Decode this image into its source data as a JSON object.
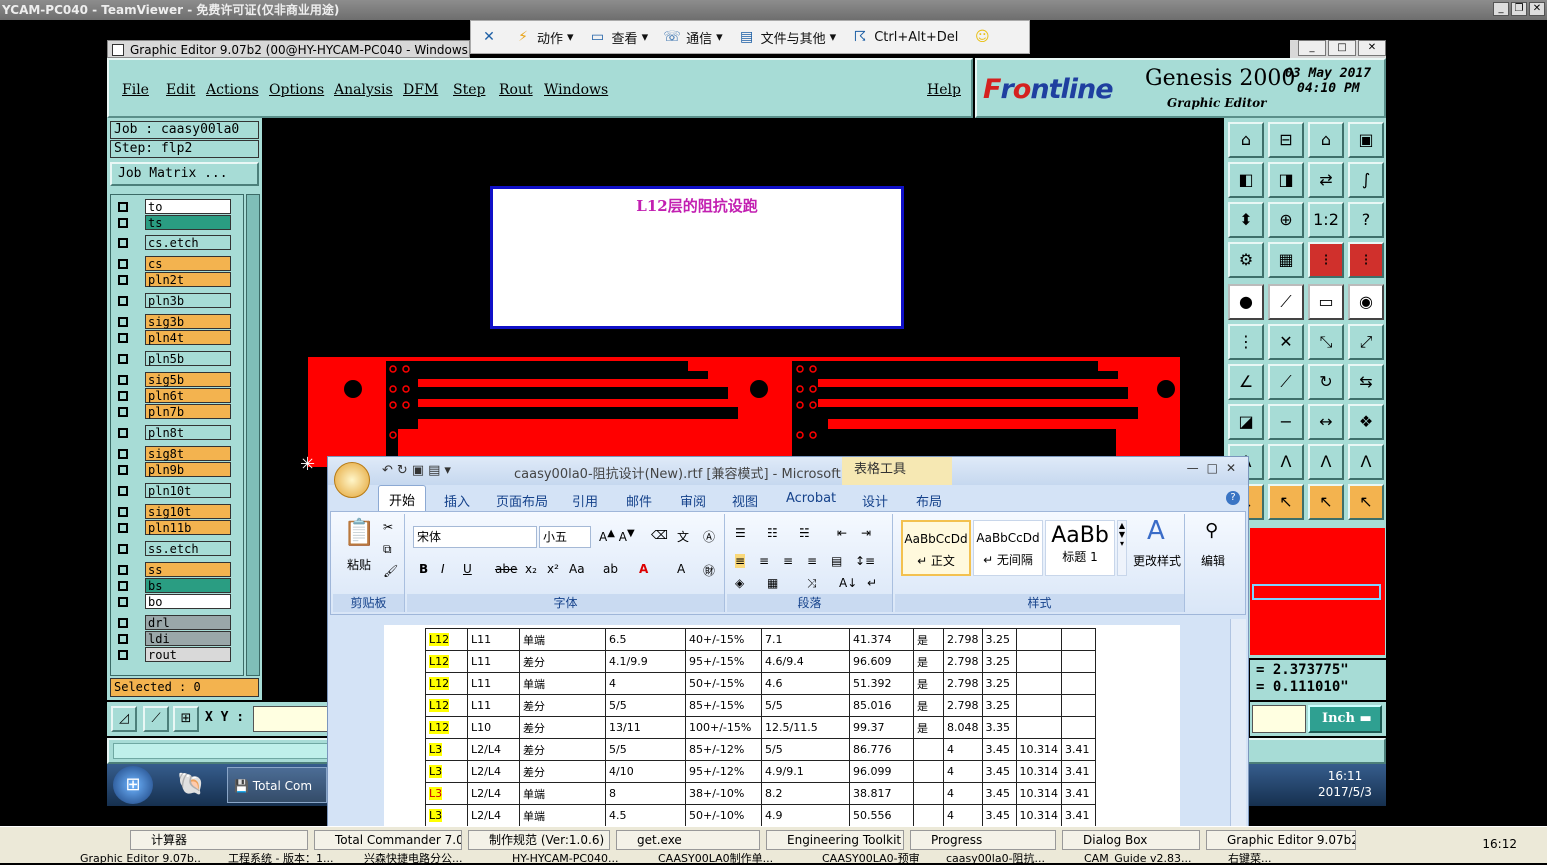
{
  "teamviewer": {
    "title": "YCAM-PC040 - TeamViewer - 免费许可证(仅非商业用途)",
    "toolbar": [
      {
        "icon": "close-x-icon",
        "label": ""
      },
      {
        "icon": "lightning-icon",
        "label": "动作"
      },
      {
        "icon": "monitor-icon",
        "label": "查看"
      },
      {
        "icon": "phone-icon",
        "label": "通信"
      },
      {
        "icon": "file-transfer-icon",
        "label": "文件与其他"
      },
      {
        "icon": "run-icon",
        "label": "Ctrl+Alt+Del"
      },
      {
        "icon": "smiley-icon",
        "label": ""
      }
    ]
  },
  "genesis": {
    "window_title": "Graphic Editor 9.07b2 (00@HY-HYCAM-PC040 - Windows,",
    "menu": [
      "File",
      "Edit",
      "Actions",
      "Options",
      "Analysis",
      "DFM",
      "Step",
      "Rout",
      "Windows",
      "Help"
    ],
    "brand": {
      "logo_a": "F",
      "logo_b": "r",
      "logo_c": "o",
      "logo_d": "ntline",
      "product": "Genesis 2000",
      "subtitle": "Graphic Editor",
      "date": "03 May 2017",
      "time": "04:10 PM"
    },
    "job": "Job : caasy00la0",
    "step": "Step: flp2",
    "job_matrix": "Job Matrix ...",
    "layers": [
      {
        "name": "to",
        "color": "#ffffff"
      },
      {
        "name": "ts",
        "color": "#2a9d82"
      },
      {
        "name": "cs.etch",
        "color": "#a7dcd6"
      },
      {
        "name": "cs",
        "color": "#f3b34f"
      },
      {
        "name": "pln2t",
        "color": "#f3b34f"
      },
      {
        "name": "pln3b",
        "color": "#a7dcd6"
      },
      {
        "name": "sig3b",
        "color": "#f3b34f"
      },
      {
        "name": "pln4t",
        "color": "#f3b34f"
      },
      {
        "name": "pln5b",
        "color": "#a7dcd6"
      },
      {
        "name": "sig5b",
        "color": "#f3b34f"
      },
      {
        "name": "pln6t",
        "color": "#f3b34f"
      },
      {
        "name": "pln7b",
        "color": "#f3b34f"
      },
      {
        "name": "pln8t",
        "color": "#a7dcd6"
      },
      {
        "name": "sig8t",
        "color": "#f3b34f"
      },
      {
        "name": "pln9b",
        "color": "#f3b34f"
      },
      {
        "name": "pln10t",
        "color": "#a7dcd6"
      },
      {
        "name": "sig10t",
        "color": "#f3b34f"
      },
      {
        "name": "pln11b",
        "color": "#f3b34f"
      },
      {
        "name": "ss.etch",
        "color": "#a7dcd6"
      },
      {
        "name": "ss",
        "color": "#f3b34f"
      },
      {
        "name": "bs",
        "color": "#2a9d82"
      },
      {
        "name": "bo",
        "color": "#ffffff"
      },
      {
        "name": "drl",
        "color": "#9aa7a9"
      },
      {
        "name": "ldi",
        "color": "#9aa7a9"
      },
      {
        "name": "rout",
        "color": "#d9d9d9"
      }
    ],
    "selected": "Selected : 0",
    "xy_label": "X Y :",
    "note_text": "L12层的阻抗设跑",
    "coord_x": "= 2.373775\"",
    "coord_y": "= 0.111010\"",
    "units": "Inch"
  },
  "word": {
    "doc_title": "caasy00la0-阻抗设计(New).rtf [兼容模式] - Microsoft W...",
    "context_tab": "表格工具",
    "tabs": [
      "开始",
      "插入",
      "页面布局",
      "引用",
      "邮件",
      "审阅",
      "视图",
      "Acrobat",
      "设计",
      "布局"
    ],
    "groups": {
      "clipboard": "剪贴板",
      "paste": "粘贴",
      "font": "字体",
      "font_name": "宋体",
      "font_size": "小五",
      "paragraph": "段落",
      "styles": "样式",
      "change_styles": "更改样式",
      "edit": "编辑"
    },
    "style_tiles": [
      {
        "sample": "AaBbCcDd",
        "name": "↵ 正文"
      },
      {
        "sample": "AaBbCcDd",
        "name": "↵ 无间隔"
      },
      {
        "sample": "AaBb",
        "name": "标题 1"
      }
    ],
    "table": [
      [
        "L12",
        "L11",
        "单端",
        "6.5",
        "40+/-15%",
        "7.1",
        "41.374",
        "是",
        "2.798",
        "3.25",
        "",
        ""
      ],
      [
        "L12",
        "L11",
        "差分",
        "4.1/9.9",
        "95+/-15%",
        "4.6/9.4",
        "96.609",
        "是",
        "2.798",
        "3.25",
        "",
        ""
      ],
      [
        "L12",
        "L11",
        "单端",
        "4",
        "50+/-15%",
        "4.6",
        "51.392",
        "是",
        "2.798",
        "3.25",
        "",
        ""
      ],
      [
        "L12",
        "L11",
        "差分",
        "5/5",
        "85+/-15%",
        "5/5",
        "85.016",
        "是",
        "2.798",
        "3.25",
        "",
        ""
      ],
      [
        "L12",
        "L10",
        "差分",
        "13/11",
        "100+/-15%",
        "12.5/11.5",
        "99.37",
        "是",
        "8.048",
        "3.35",
        "",
        ""
      ],
      [
        "L3",
        "L2/L4",
        "差分",
        "5/5",
        "85+/-12%",
        "5/5",
        "86.776",
        "",
        "4",
        "3.45",
        "10.314",
        "3.41"
      ],
      [
        "L3",
        "L2/L4",
        "差分",
        "4/10",
        "95+/-12%",
        "4.9/9.1",
        "96.099",
        "",
        "4",
        "3.45",
        "10.314",
        "3.41"
      ],
      [
        "L3",
        "L2/L4",
        "单端",
        "8",
        "38+/-10%",
        "8.2",
        "38.817",
        "",
        "4",
        "3.45",
        "10.314",
        "3.41"
      ],
      [
        "L3",
        "L2/L4",
        "单端",
        "4.5",
        "50+/-10%",
        "4.9",
        "50.556",
        "",
        "4",
        "3.45",
        "10.314",
        "3.41"
      ]
    ]
  },
  "remote_taskbar": {
    "item": "Total Com",
    "time": "16:11",
    "date": "2017/5/3"
  },
  "local_taskbar": {
    "row1": [
      "计算器",
      "Total Commander 7.0 ...",
      "制作规范 (Ver:1.0.6)",
      "get.exe",
      "Engineering Toolkit 9....",
      "Progress",
      "Dialog Box",
      "Graphic Editor 9.07b2 ..."
    ],
    "row2": [
      "Graphic Editor 9.07b...",
      "工程系统 - 版本：1...",
      "兴森快捷电路分公...",
      "HY-HYCAM-PC040...",
      "CAASY00LA0制作单...",
      "CAASY00LA0-预审...",
      "caasy00la0-阻抗...",
      "CAM_Guide v2.83...",
      "右键菜..."
    ],
    "time": "16:12"
  }
}
